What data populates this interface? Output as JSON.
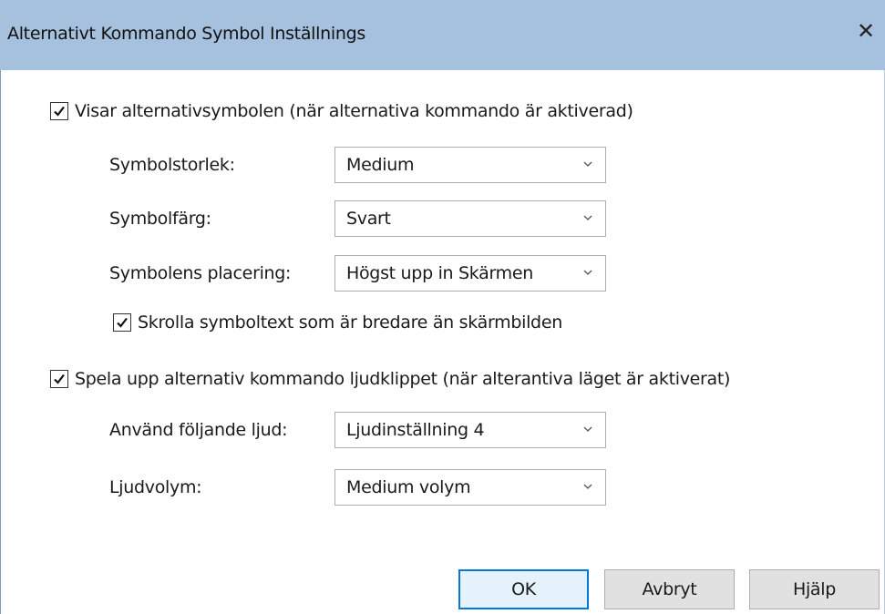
{
  "window": {
    "title": "Alternativt Kommando Symbol Inställnings",
    "close_label": "✕",
    "titlebar_color": "#a5c1de"
  },
  "show_symbol": {
    "checked": true,
    "label": "Visar alternativsymbolen (när alternativa kommando är aktiverad)"
  },
  "symbol_size": {
    "label": "Symbolstorlek:",
    "value": "Medium"
  },
  "symbol_color": {
    "label": "Symbolfärg:",
    "value": "Svart"
  },
  "symbol_position": {
    "label": "Symbolens placering:",
    "value": "Högst upp in Skärmen"
  },
  "scroll_text": {
    "checked": true,
    "label": "Skrolla symboltext som är bredare än skärmbilden"
  },
  "play_sound": {
    "checked": true,
    "label": "Spela upp alternativ kommando ljudklippet (när alterantiva läget är aktiverat)"
  },
  "sound_choice": {
    "label": "Använd följande ljud:",
    "value": "Ljudinställning 4"
  },
  "sound_volume": {
    "label": "Ljudvolym:",
    "value": "Medium volym"
  },
  "buttons": {
    "ok": "OK",
    "cancel": "Avbryt",
    "help": "Hjälp"
  },
  "icons": {
    "checkmark": "checkmark-icon",
    "chevron": "chevron-down-icon",
    "close": "close-icon"
  }
}
